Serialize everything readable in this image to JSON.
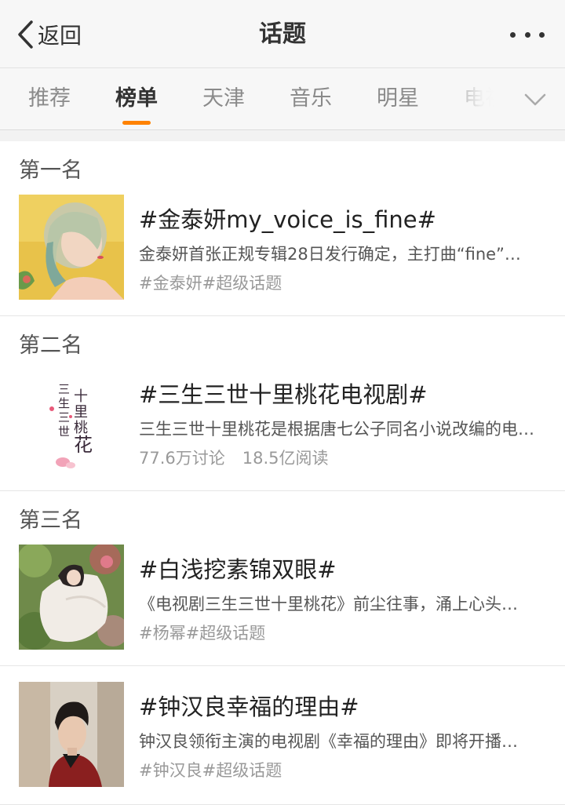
{
  "nav": {
    "back_label": "返回",
    "title": "话题"
  },
  "tabs": [
    {
      "label": "推荐",
      "active": false
    },
    {
      "label": "榜单",
      "active": true
    },
    {
      "label": "天津",
      "active": false
    },
    {
      "label": "音乐",
      "active": false
    },
    {
      "label": "明星",
      "active": false
    },
    {
      "label": "电视",
      "active": false
    }
  ],
  "topics": [
    {
      "rank": "第一名",
      "title": "#金泰妍my_voice_is_fine#",
      "desc": "金泰妍首张正规专辑28日发行确定，主打曲“fine”…",
      "meta": "#金泰妍#超级话题"
    },
    {
      "rank": "第二名",
      "title": "#三生三世十里桃花电视剧#",
      "desc": "  三生三世十里桃花是根据唐七公子同名小说改编的电视剧…",
      "meta_discuss": "77.6万讨论",
      "meta_read": "18.5亿阅读",
      "thumb_text": "三生三世十里桃花"
    },
    {
      "rank": "第三名",
      "title": "#白浅挖素锦双眼#",
      "desc": "《电视剧三生三世十里桃花》前尘往事，涌上心头…",
      "meta": "#杨幂#超级话题"
    },
    {
      "rank": "",
      "title": "#钟汉良幸福的理由#",
      "desc": "钟汉良领衔主演的电视剧《幸福的理由》即将开播…",
      "meta": "#钟汉良#超级话题"
    }
  ],
  "colors": {
    "accent": "#ff8200",
    "background": "#f2f2f2"
  }
}
